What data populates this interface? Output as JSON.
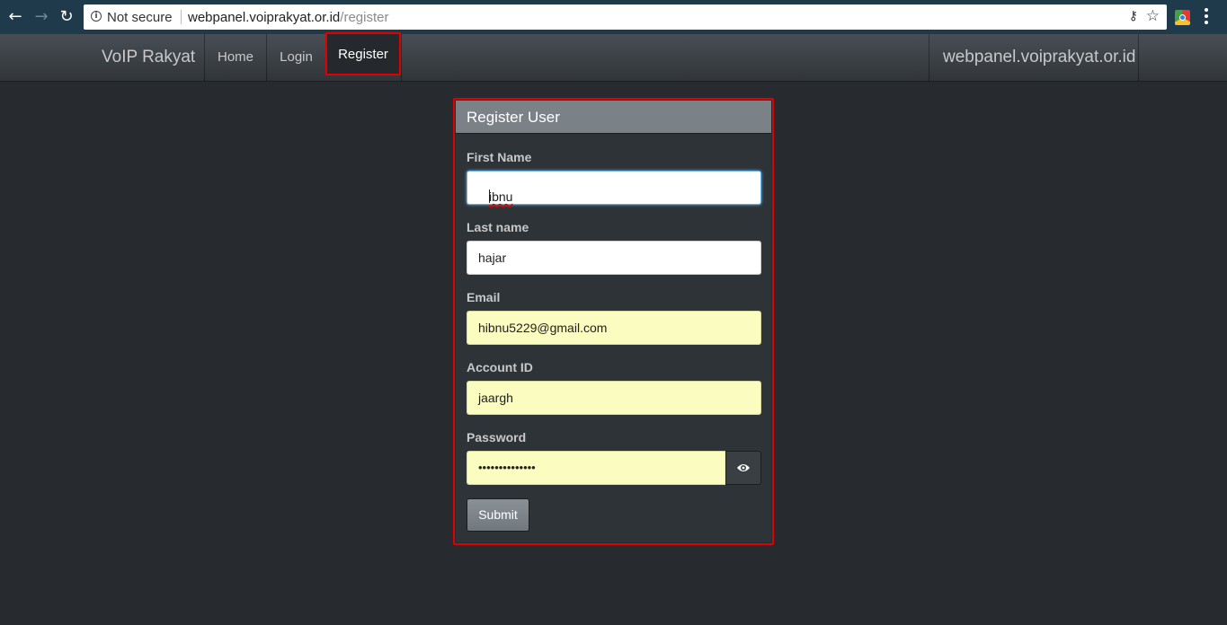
{
  "browser": {
    "security_label": "Not secure",
    "url_host": "webpanel.voiprakyat.or.id",
    "url_path": "/register"
  },
  "navbar": {
    "brand": "VoIP Rakyat",
    "items": [
      {
        "label": "Home"
      },
      {
        "label": "Login"
      },
      {
        "label": "Register"
      }
    ],
    "site_name": "webpanel.voiprakyat.or.id",
    "active_item": "Register"
  },
  "form": {
    "title": "Register User",
    "first_name": {
      "label": "First Name",
      "value": "ibnu"
    },
    "last_name": {
      "label": "Last name",
      "value": "hajar"
    },
    "email": {
      "label": "Email",
      "value": "hibnu5229@gmail.com"
    },
    "account_id": {
      "label": "Account ID",
      "value": "jaargh"
    },
    "password": {
      "label": "Password",
      "value": "••••••••••••••"
    },
    "submit_label": "Submit"
  },
  "colors": {
    "background": "#272b30",
    "highlight_outline": "#e00000",
    "autofill": "#fafcc0",
    "header": "#7a8288"
  }
}
